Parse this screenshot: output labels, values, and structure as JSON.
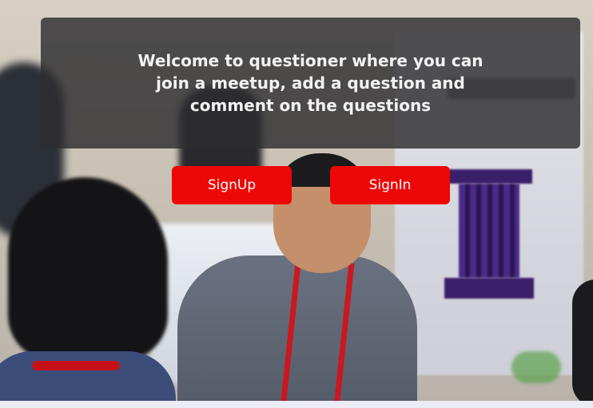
{
  "hero": {
    "welcome_message": "Welcome to questioner where you can join a meetup, add a question and comment on the questions",
    "background_image": "people-at-meetup-photo"
  },
  "actions": {
    "signup_label": "SignUp",
    "signin_label": "SignIn"
  },
  "colors": {
    "button_bg": "#ee0707",
    "button_text": "#ffffff",
    "panel_bg": "rgba(45,45,48,0.82)",
    "panel_text": "#f2f2f2"
  }
}
